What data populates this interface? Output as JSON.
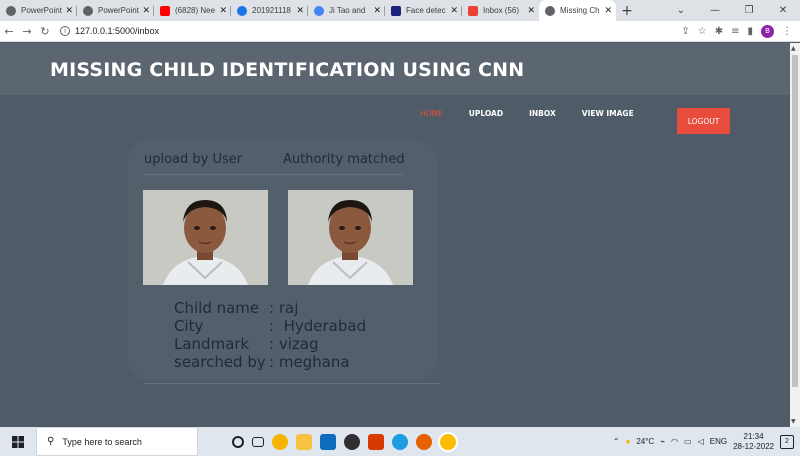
{
  "browser": {
    "tabs": [
      {
        "title": "PowerPoint",
        "color": "#5f6368"
      },
      {
        "title": "PowerPoint",
        "color": "#5f6368"
      },
      {
        "title": "(6828) Nee",
        "color": "#ff0000"
      },
      {
        "title": "201921118",
        "color": "#1a73e8"
      },
      {
        "title": "Ji Tao and",
        "color": "#4285f4"
      },
      {
        "title": "Face detec",
        "color": "#1a237e"
      },
      {
        "title": "Inbox (56)",
        "color": "#ea4335"
      },
      {
        "title": "Missing Ch",
        "color": "#5f6368",
        "active": true
      }
    ],
    "new_tab": "+",
    "url": "127.0.0.1:5000/inbox"
  },
  "site": {
    "title": "MISSING CHILD IDENTIFICATION USING CNN",
    "nav": {
      "home": "HOME",
      "upload": "UPLOAD",
      "inbox": "INBOX",
      "view_image": "VIEW IMAGE",
      "logout": "LOGOUT"
    },
    "colors": {
      "accent": "#e74c3c",
      "background": "#4f5b66",
      "header": "#5b6670"
    }
  },
  "match": {
    "col1_heading": "upload by User",
    "col2_heading": "Authority matched",
    "details": [
      {
        "label": "Child name",
        "sep": ":",
        "value": "raj"
      },
      {
        "label": "City",
        "sep": ":",
        "value": "Hyderabad"
      },
      {
        "label": "Landmark",
        "sep": ":",
        "value": "vizag"
      },
      {
        "label": "searched by",
        "sep": ":",
        "value": "meghana"
      }
    ]
  },
  "taskbar": {
    "search_placeholder": "Type here to search",
    "weather": "24°C",
    "language": "ENG",
    "time": "21:34",
    "date": "28-12-2022",
    "notifications": "2"
  }
}
